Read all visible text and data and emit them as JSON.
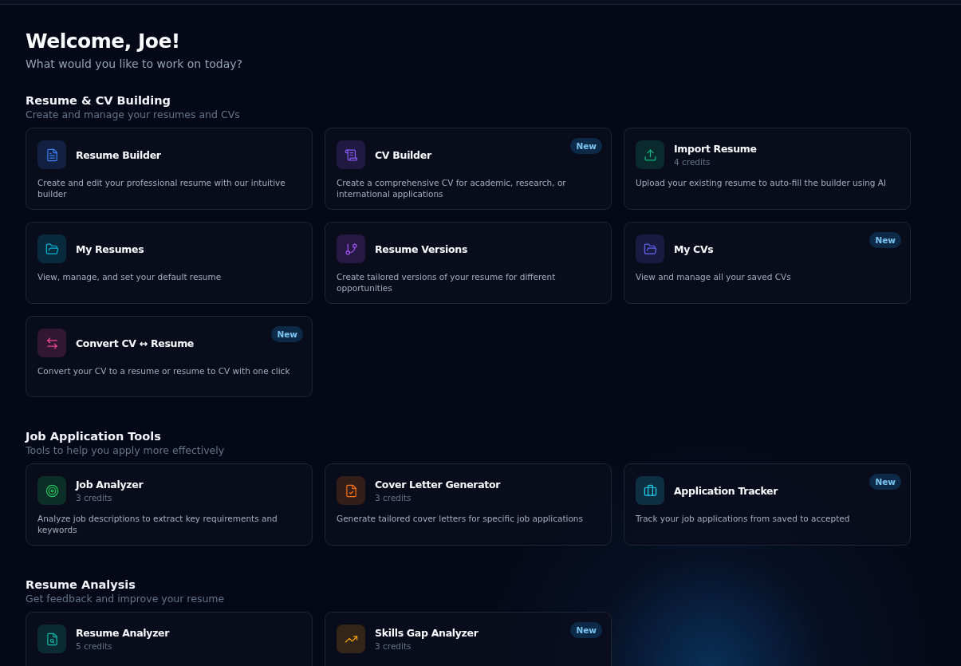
{
  "header": {
    "title": "Welcome, Joe!",
    "subtitle": "What would you like to work on today?"
  },
  "sections": [
    {
      "title": "Resume & CV Building",
      "subtitle": "Create and manage your resumes and CVs",
      "cards": [
        {
          "title": "Resume Builder",
          "description": "Create and edit your professional resume with our intuitive builder",
          "color": "#3b82f6",
          "is_new": false
        },
        {
          "title": "CV Builder",
          "description": "Create a comprehensive CV for academic, research, or international applications",
          "color": "#8b5cf6",
          "is_new": true,
          "badge": "New"
        },
        {
          "title": "Import Resume",
          "credits": "4 credits",
          "description": "Upload your existing resume to auto-fill the builder using AI",
          "color": "#10b981",
          "is_new": false
        },
        {
          "title": "My Resumes",
          "description": "View, manage, and set your default resume",
          "color": "#06b6d4",
          "is_new": false
        },
        {
          "title": "Resume Versions",
          "description": "Create tailored versions of your resume for different opportunities",
          "color": "#a855f7",
          "is_new": false
        },
        {
          "title": "My CVs",
          "description": "View and manage all your saved CVs",
          "color": "#6366f1",
          "is_new": true,
          "badge": "New"
        },
        {
          "title": "Convert CV ↔ Resume",
          "description": "Convert your CV to a resume or resume to CV with one click",
          "color": "#ec4899",
          "is_new": true,
          "badge": "New"
        }
      ]
    },
    {
      "title": "Job Application Tools",
      "subtitle": "Tools to help you apply more effectively",
      "cards": [
        {
          "title": "Job Analyzer",
          "credits": "3 credits",
          "description": "Analyze job descriptions to extract key requirements and keywords",
          "color": "#22c55e",
          "is_new": false
        },
        {
          "title": "Cover Letter Generator",
          "credits": "3 credits",
          "description": "Generate tailored cover letters for specific job applications",
          "color": "#f97316",
          "is_new": false
        },
        {
          "title": "Application Tracker",
          "description": "Track your job applications from saved to accepted",
          "color": "#22d3ee",
          "is_new": true,
          "badge": "New"
        }
      ]
    },
    {
      "title": "Resume Analysis",
      "subtitle": "Get feedback and improve your resume",
      "cards": [
        {
          "title": "Resume Analyzer",
          "credits": "5 credits",
          "color": "#14b8a6",
          "is_new": false
        },
        {
          "title": "Skills Gap Analyzer",
          "credits": "3 credits",
          "color": "#f59e0b",
          "is_new": true,
          "badge": "New"
        }
      ]
    }
  ]
}
